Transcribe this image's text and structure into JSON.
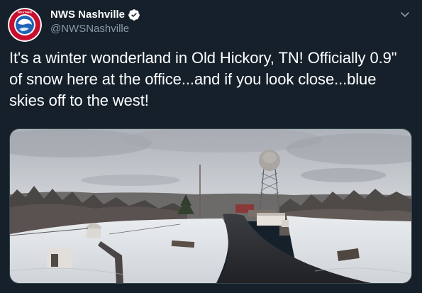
{
  "author": {
    "display_name": "NWS Nashville",
    "handle": "@NWSNashville",
    "verified": true,
    "avatar_icon": "nws-logo-icon"
  },
  "tweet": {
    "text": "It's a winter wonderland in Old Hickory, TN! Officially 0.9\" of snow here at the office...and if you look close...blue skies off to the west!"
  },
  "media": {
    "image_description_icon": "snowy-landscape-photo"
  },
  "colors": {
    "background": "#15202b",
    "text_primary": "#ffffff",
    "text_secondary": "#8899a6",
    "verified_blue": "#1da1f2"
  }
}
